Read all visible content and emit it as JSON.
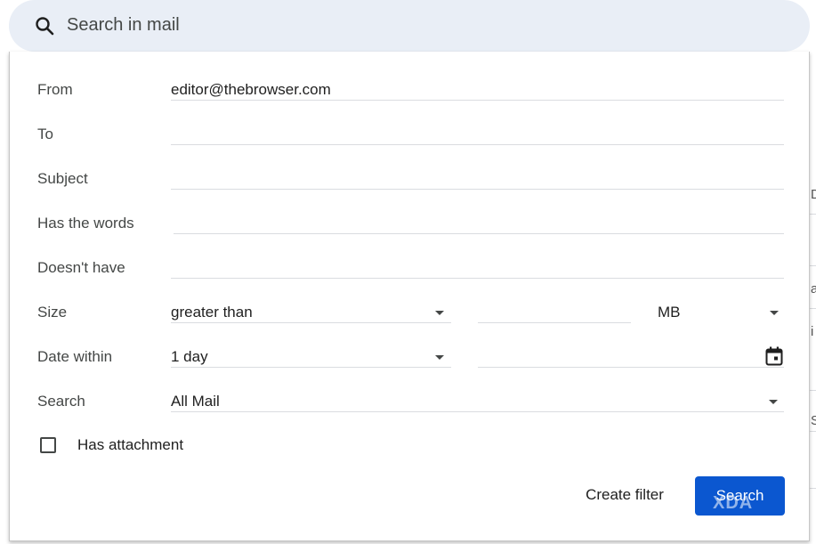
{
  "search": {
    "placeholder": "Search in mail",
    "icon": "search-icon"
  },
  "form": {
    "from_label": "From",
    "from_value": "editor@thebrowser.com",
    "to_label": "To",
    "to_value": "",
    "subject_label": "Subject",
    "subject_value": "",
    "has_words_label": "Has the words",
    "has_words_value": "",
    "doesnt_have_label": "Doesn't have",
    "doesnt_have_value": "",
    "size_label": "Size",
    "size_operator": "greater than",
    "size_value": "",
    "size_unit": "MB",
    "date_within_label": "Date within",
    "date_within_value": "1 day",
    "date_value": "",
    "search_label": "Search",
    "search_scope": "All Mail",
    "has_attachment_label": "Has attachment",
    "has_attachment_checked": false
  },
  "actions": {
    "create_filter": "Create filter",
    "search": "Search"
  },
  "watermark": "XDA",
  "colors": {
    "search_bar_bg": "#e9eef6",
    "primary_button": "#0b57d0",
    "divider": "#dadce0"
  }
}
